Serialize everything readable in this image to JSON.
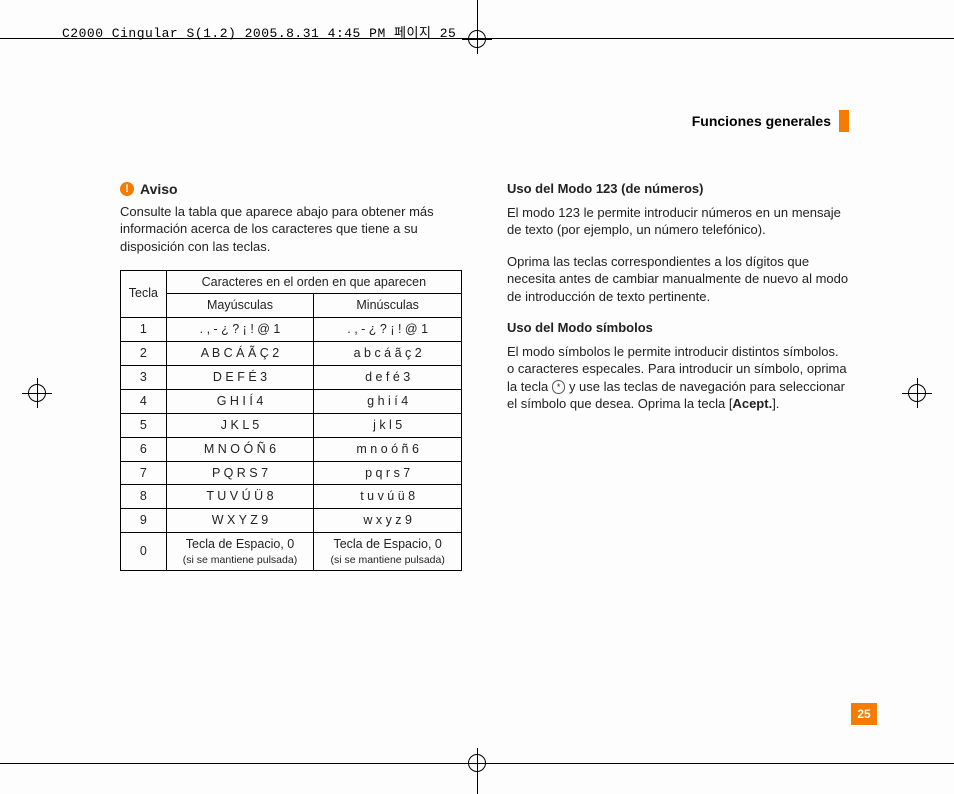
{
  "header": "C2000 Cingular  S(1.2)  2005.8.31 4:45 PM 페이지 25",
  "section_title": "Funciones generales",
  "page_number": "25",
  "aviso": {
    "label": "Aviso",
    "text": "Consulte la tabla que aparece abajo para obtener más información acerca de los caracteres que tiene a su disposición con las teclas."
  },
  "table": {
    "col_key": "Tecla",
    "col_order": "Caracteres en el orden en que aparecen",
    "col_upper": "Mayúsculas",
    "col_lower": "Minúsculas",
    "rows": [
      {
        "k": "1",
        "u": ". , - ¿ ? ¡ ! @ 1",
        "l": ". , - ¿ ? ¡ ! @ 1"
      },
      {
        "k": "2",
        "u": "A B C Á Ã Ç 2",
        "l": "a b c á ã ç 2"
      },
      {
        "k": "3",
        "u": "D E F É 3",
        "l": "d e f é 3"
      },
      {
        "k": "4",
        "u": "G H I Í 4",
        "l": "g h i í 4"
      },
      {
        "k": "5",
        "u": "J K L 5",
        "l": "j k l 5"
      },
      {
        "k": "6",
        "u": "M N O Ó Ñ 6",
        "l": "m n o ó ñ 6"
      },
      {
        "k": "7",
        "u": "P Q R S 7",
        "l": "p q r s 7"
      },
      {
        "k": "8",
        "u": "T U V Ú Ü 8",
        "l": "t u v ú ü 8"
      },
      {
        "k": "9",
        "u": "W X Y Z 9",
        "l": "w x y z 9"
      },
      {
        "k": "0",
        "u": "Tecla de Espacio, 0",
        "us": "(si se mantiene pulsada)",
        "l": "Tecla de Espacio, 0",
        "ls": "(si se mantiene pulsada)"
      }
    ]
  },
  "right": {
    "h1": "Uso del Modo 123 (de números)",
    "p1": "El modo 123 le permite introducir números en un mensaje de texto (por ejemplo, un número telefónico).",
    "p2": "Oprima las teclas correspondientes a los dígitos que necesita antes de cambiar manualmente de nuevo al modo de introducción de texto pertinente.",
    "h2": "Uso del Modo símbolos",
    "p3a": "El modo símbolos le permite introducir distintos símbolos. o caracteres especales. Para introducir un símbolo, oprima la tecla ",
    "key": "*",
    "p3b": " y use las teclas de navegación para seleccionar el símbolo que desea. Oprima la tecla [",
    "bold": "Acept.",
    "p3c": "]."
  }
}
